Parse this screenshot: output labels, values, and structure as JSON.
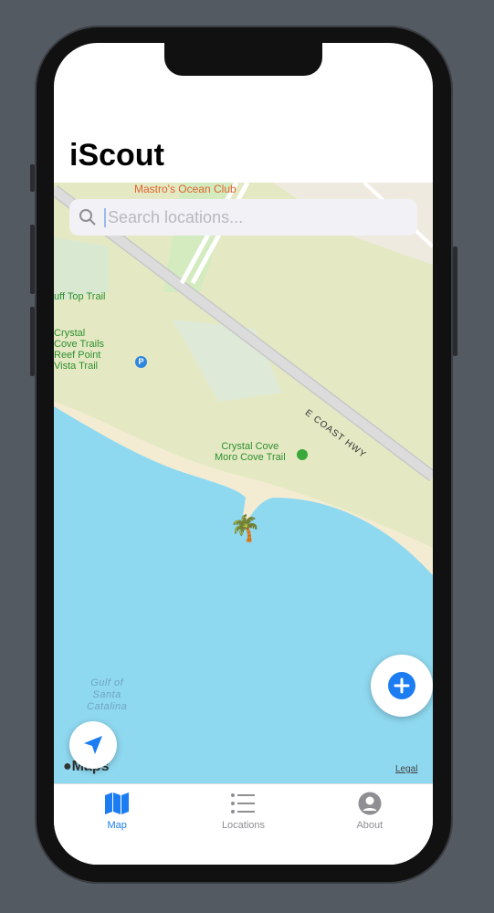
{
  "app": {
    "title": "iScout"
  },
  "search": {
    "placeholder": "Search locations..."
  },
  "map": {
    "labels": {
      "restaurant": "Mastro's Ocean Club",
      "bluff": "uff Top Trail",
      "crystal_trails": "Crystal\nCove Trails\nReef Point\nVista Trail",
      "parking": "P",
      "moro": "Crystal Cove\nMoro Cove Trail",
      "highway": "E COAST HWY",
      "water": "Gulf of\nSanta\nCatalina"
    },
    "pin": "🌴",
    "attribution": "Maps",
    "legal": "Legal"
  },
  "tabs": [
    {
      "label": "Map",
      "icon": "map-icon",
      "active": true
    },
    {
      "label": "Locations",
      "icon": "list-icon",
      "active": false
    },
    {
      "label": "About",
      "icon": "person-circle-icon",
      "active": false
    }
  ],
  "colors": {
    "accent": "#1c7cf2",
    "water": "#8fd9f0",
    "land": "#e4e9c4",
    "beach": "#f3ecd2"
  }
}
